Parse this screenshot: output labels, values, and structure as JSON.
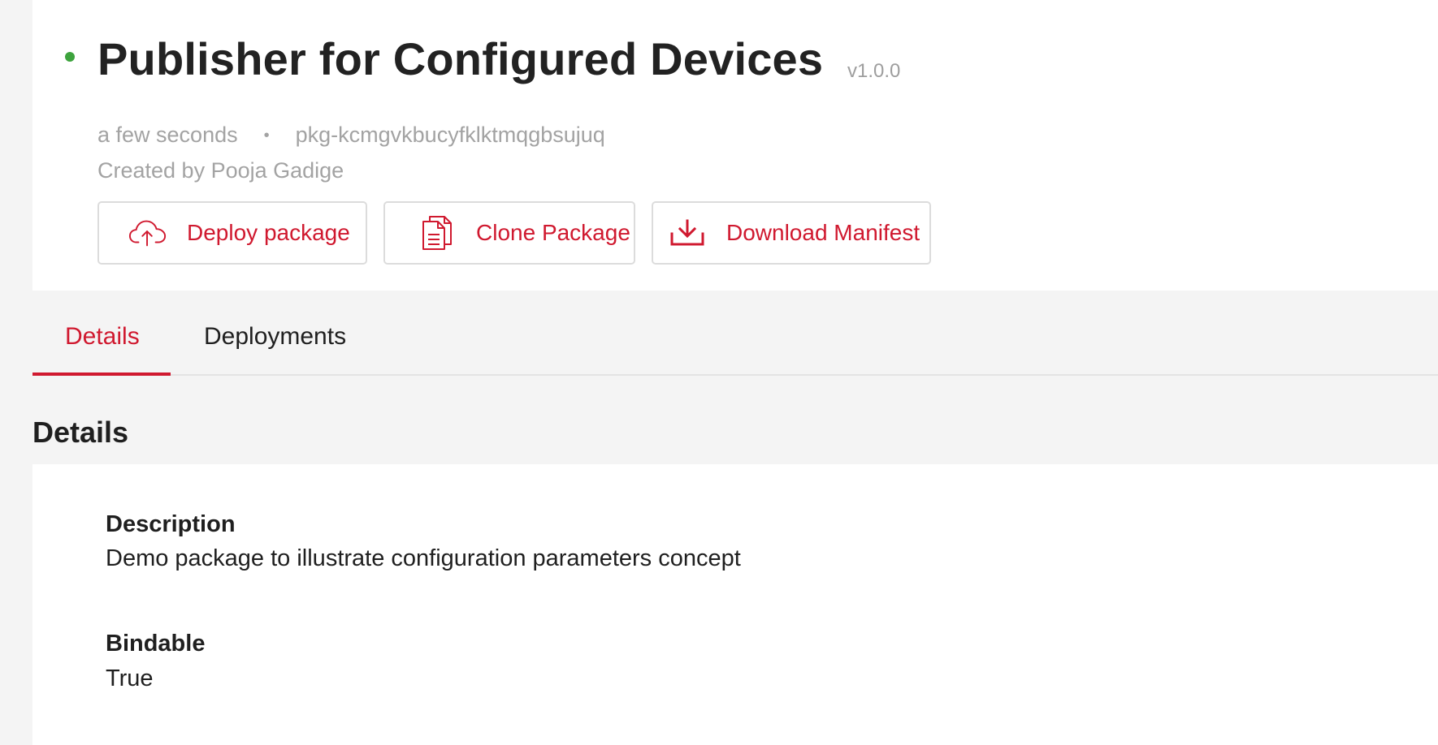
{
  "colors": {
    "accent": "#d0192f",
    "status_active": "#3da33d"
  },
  "header": {
    "title": "Publisher for Configured Devices",
    "version": "v1.0.0",
    "status_icon": "status-dot-icon",
    "timestamp": "a few seconds",
    "separator": "•",
    "package_id": "pkg-kcmgvkbucyfklktmqgbsujuq",
    "created_by": "Created by Pooja Gadige"
  },
  "actions": [
    {
      "label": "Deploy package",
      "icon": "cloud-upload-icon"
    },
    {
      "label": "Clone Package",
      "icon": "copy-document-icon"
    },
    {
      "label": "Download Manifest",
      "icon": "download-icon"
    }
  ],
  "tabs": [
    {
      "label": "Details",
      "active": true
    },
    {
      "label": "Deployments",
      "active": false
    }
  ],
  "details": {
    "heading": "Details",
    "fields": [
      {
        "label": "Description",
        "value": "Demo package to illustrate configuration parameters concept"
      },
      {
        "label": "Bindable",
        "value": "True"
      }
    ]
  }
}
